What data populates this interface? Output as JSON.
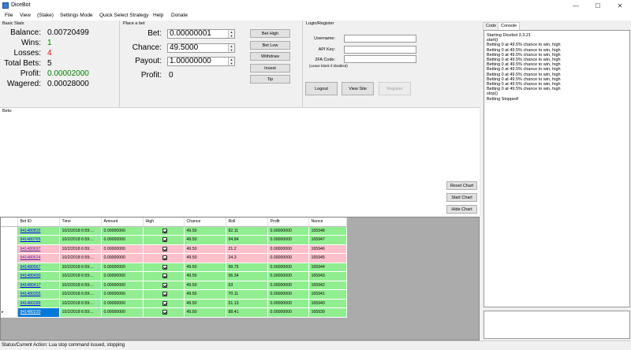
{
  "window": {
    "title": "DiceBot"
  },
  "menu": [
    "File",
    "View",
    "(Stake)",
    "Settings Mode",
    "Quick Select Strategy",
    "Help",
    "Donate"
  ],
  "basic_stats": {
    "title": "Basic Stats",
    "balance_label": "Balance:",
    "balance": "0.00720499",
    "wins_label": "Wins:",
    "wins": "1",
    "losses_label": "Losses:",
    "losses": "4",
    "total_bets_label": "Total Bets:",
    "total_bets": "5",
    "profit_label": "Profit:",
    "profit": "0.00002000",
    "wagered_label": "Wagered:",
    "wagered": "0.00028000"
  },
  "place_bet": {
    "title": "Place a bet",
    "bet_label": "Bet:",
    "bet_value": "0.00000001",
    "chance_label": "Chance:",
    "chance_value": "49.5000",
    "payout_label": "Payout:",
    "payout_value": "1.00000000",
    "profit_label": "Profit:",
    "profit_value": "0",
    "buttons": {
      "bet_high": "Bet High",
      "bet_low": "Bet Low",
      "withdraw": "Withdraw",
      "invest": "Invest",
      "tip": "Tip"
    }
  },
  "login": {
    "title": "Login/Register",
    "username_label": "Username:",
    "api_key_label": "API Key:",
    "twofa_label": "2FA Code:",
    "twofa_note": "(Leave blank if disabled)",
    "logout": "Logout",
    "view_site": "View Site",
    "register": "Register"
  },
  "bets": {
    "title": "Bets:",
    "reset_chart": "Reset Chart",
    "start_chart": "Start Chart",
    "hide_chart": "Hide Chart"
  },
  "grid": {
    "columns": [
      "Bet ID",
      "Time",
      "Amount",
      "High",
      "Chance",
      "Roll",
      "Profit",
      "Nonce"
    ],
    "rows": [
      {
        "id": "941480832",
        "time": "10/2/2018 6:59:...",
        "amount": "0.00000000",
        "chance": "49.50",
        "roll": "82.11",
        "profit": "0.00000000",
        "nonce": "165948",
        "result": "win"
      },
      {
        "id": "941480765",
        "time": "10/2/2018 6:59:...",
        "amount": "0.00000000",
        "chance": "49.50",
        "roll": "94.84",
        "profit": "0.00000000",
        "nonce": "165947",
        "result": "win"
      },
      {
        "id": "941480697",
        "time": "10/2/2018 6:59:...",
        "amount": "0.00000000",
        "chance": "49.50",
        "roll": "21.2",
        "profit": "0.00000000",
        "nonce": "165946",
        "result": "lose"
      },
      {
        "id": "941480624",
        "time": "10/2/2018 6:59:...",
        "amount": "0.00000000",
        "chance": "49.50",
        "roll": "24.3",
        "profit": "0.00000000",
        "nonce": "165945",
        "result": "lose"
      },
      {
        "id": "941480567",
        "time": "10/2/2018 6:59:...",
        "amount": "0.00000000",
        "chance": "49.50",
        "roll": "99.75",
        "profit": "0.00000000",
        "nonce": "165944",
        "result": "win"
      },
      {
        "id": "941480490",
        "time": "10/2/2018 6:59:...",
        "amount": "0.00000000",
        "chance": "49.50",
        "roll": "56.34",
        "profit": "0.00000000",
        "nonce": "165943",
        "result": "win"
      },
      {
        "id": "941480417",
        "time": "10/2/2018 6:59:...",
        "amount": "0.00000000",
        "chance": "49.50",
        "roll": "63",
        "profit": "0.00000000",
        "nonce": "165942",
        "result": "win"
      },
      {
        "id": "941480355",
        "time": "10/2/2018 6:59:...",
        "amount": "0.00000000",
        "chance": "49.50",
        "roll": "70.11",
        "profit": "0.00000000",
        "nonce": "165941",
        "result": "win"
      },
      {
        "id": "941480289",
        "time": "10/2/2018 6:59:...",
        "amount": "0.00000000",
        "chance": "49.50",
        "roll": "51.13",
        "profit": "0.00000000",
        "nonce": "165940",
        "result": "win"
      },
      {
        "id": "941480220",
        "time": "10/2/2018 6:59:...",
        "amount": "0.00000000",
        "chance": "49.50",
        "roll": "88.41",
        "profit": "0.00000000",
        "nonce": "165939",
        "result": "win"
      }
    ]
  },
  "right_panel": {
    "tabs": [
      "Code",
      "Console"
    ],
    "console_lines": [
      "Starting Dicebot 3.3.21",
      "start()",
      "Betting 0 at 49.5% chance to win, high",
      "Betting 0 at 49.5% chance to win, high",
      "Betting 0 at 49.5% chance to win, high",
      "Betting 0 at 49.5% chance to win, high",
      "Betting 0 at 49.5% chance to win, high",
      "Betting 0 at 49.5% chance to win, high",
      "Betting 0 at 49.5% chance to win, high",
      "Betting 0 at 49.5% chance to win, high",
      "Betting 0 at 49.5% chance to win, high",
      "Betting 0 at 49.5% chance to win, high",
      "stop()",
      "Betting Stopped!"
    ]
  },
  "status": {
    "text": "Status/Current Action:  Lua stop command issued, stopping"
  },
  "colors": {
    "win_row": "#90ee90",
    "lose_row": "#ffc0cb",
    "wins_value": "#008000",
    "losses_value": "#ff0000",
    "profit_value": "#008000"
  }
}
